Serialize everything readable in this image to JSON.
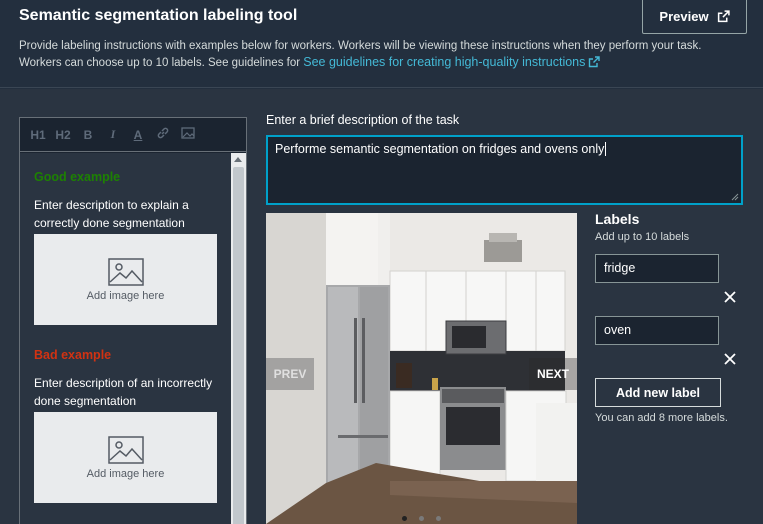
{
  "header": {
    "title": "Semantic segmentation labeling tool",
    "description": "Provide labeling instructions with examples below for workers. Workers will be viewing these instructions when they perform your task. Workers can choose up to 10 labels. See guidelines for ",
    "link_text": "See guidelines for creating high-quality instructions",
    "preview_label": "Preview"
  },
  "editor": {
    "toolbar": [
      "H1",
      "H2",
      "B",
      "I",
      "A",
      "link",
      "image"
    ],
    "good_heading": "Good example",
    "good_text": "Enter description to explain a correctly done segmentation",
    "bad_heading": "Bad example",
    "bad_text": "Enter description of an incorrectly done segmentation",
    "image_placeholder": "Add image here",
    "good_color": "#1d8102",
    "bad_color": "#d13212"
  },
  "task": {
    "label": "Enter a brief description of the task",
    "value": "Performe semantic segmentation on fridges and ovens only"
  },
  "carousel": {
    "prev_label": "PREV",
    "next_label": "NEXT",
    "dot_count": 3,
    "active_dot": 0
  },
  "labels": {
    "title": "Labels",
    "subtitle": "Add up to 10 labels",
    "items": [
      "fridge",
      "oven"
    ],
    "add_button": "Add new label",
    "remaining": "You can add 8 more labels."
  },
  "colors": {
    "background": "#232f3e",
    "accent": "#00a1c9",
    "link": "#44b9d6"
  }
}
